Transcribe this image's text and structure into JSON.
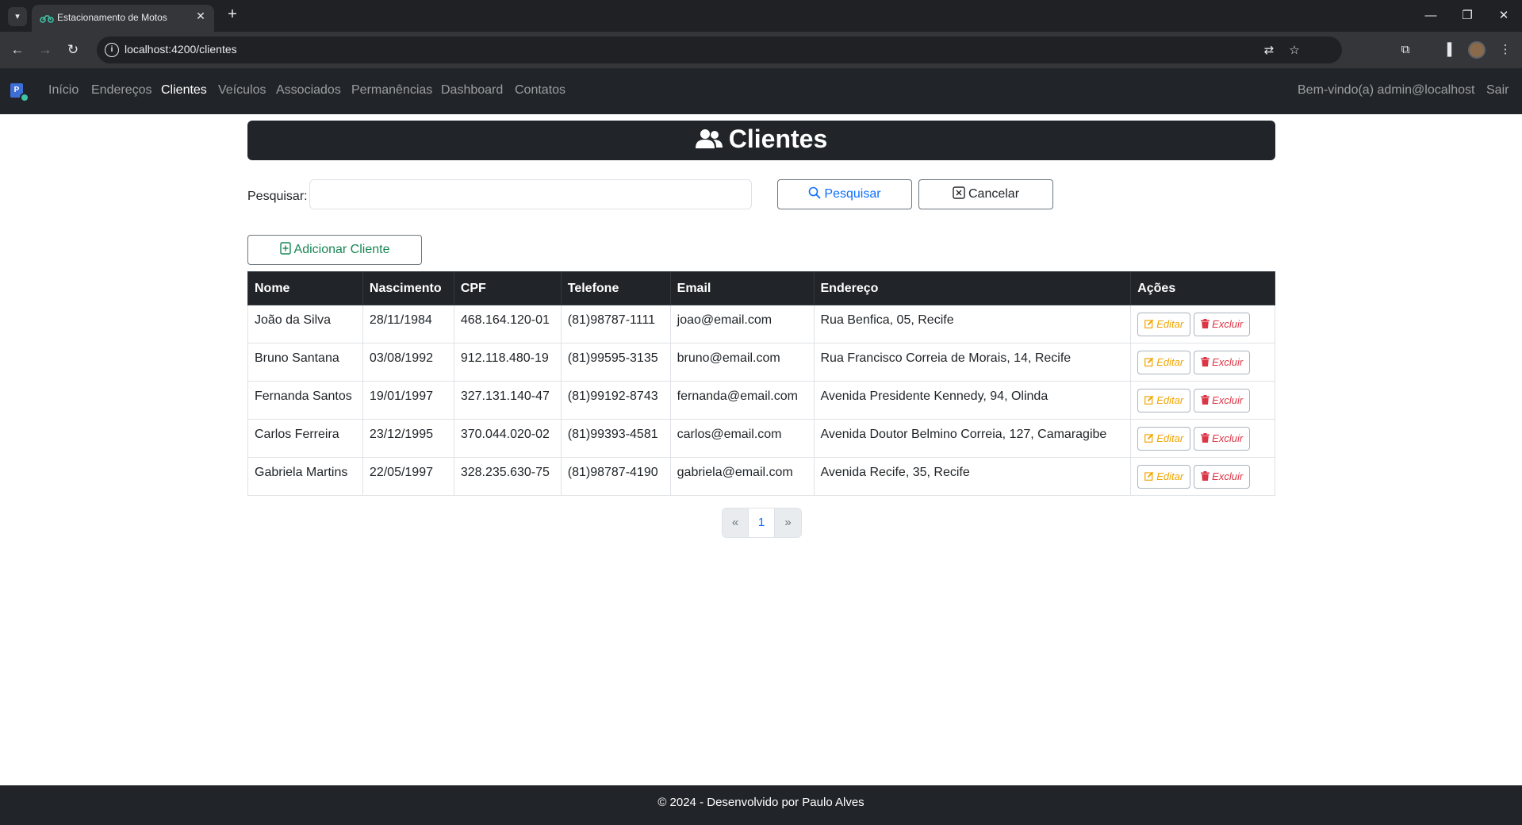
{
  "browser": {
    "tab_title": "Estacionamento de Motos",
    "url": "localhost:4200/clientes",
    "new_tab_symbol": "+",
    "icons": [
      "tab-search-icon",
      "translate-icon",
      "star-icon",
      "extensions-icon",
      "side-panel-icon",
      "profile-icon",
      "menu-icon"
    ]
  },
  "navbar": {
    "links": [
      "Início",
      "Endereços",
      "Clientes",
      "Veículos",
      "Associados",
      "Permanências",
      "Dashboard",
      "Contatos"
    ],
    "active": "Clientes",
    "welcome": "Bem-vindo(a) admin@localhost",
    "logout": "Sair"
  },
  "page": {
    "title": "Clientes",
    "search_label": "Pesquisar:",
    "search_value": "",
    "search_button": "Pesquisar",
    "cancel_button": "Cancelar",
    "add_button": "Adicionar Cliente"
  },
  "table": {
    "headers": [
      "Nome",
      "Nascimento",
      "CPF",
      "Telefone",
      "Email",
      "Endereço",
      "Ações"
    ],
    "rows": [
      [
        "João da Silva",
        "28/11/1984",
        "468.164.120-01",
        "(81)98787-1111",
        "joao@email.com",
        "Rua Benfica, 05, Recife"
      ],
      [
        "Bruno Santana",
        "03/08/1992",
        "912.118.480-19",
        "(81)99595-3135",
        "bruno@email.com",
        "Rua Francisco Correia de Morais, 14, Recife"
      ],
      [
        "Fernanda Santos",
        "19/01/1997",
        "327.131.140-47",
        "(81)99192-8743",
        "fernanda@email.com",
        "Avenida Presidente Kennedy, 94, Olinda"
      ],
      [
        "Carlos Ferreira",
        "23/12/1995",
        "370.044.020-02",
        "(81)99393-4581",
        "carlos@email.com",
        "Avenida Doutor Belmino Correia, 127, Camaragibe"
      ],
      [
        "Gabriela Martins",
        "22/05/1997",
        "328.235.630-75",
        "(81)98787-4190",
        "gabriela@email.com",
        "Avenida Recife, 35, Recife"
      ]
    ],
    "edit_label": "Editar",
    "delete_label": "Excluir"
  },
  "pagination": {
    "prev": "«",
    "current": "1",
    "next": "»"
  },
  "footer": {
    "text": "© 2024 - Desenvolvido por Paulo Alves"
  },
  "colors": {
    "navbar_bg": "#212529",
    "primary": "#0d6efd",
    "success": "#198754",
    "warning": "#f0a500",
    "danger": "#dc3545"
  }
}
